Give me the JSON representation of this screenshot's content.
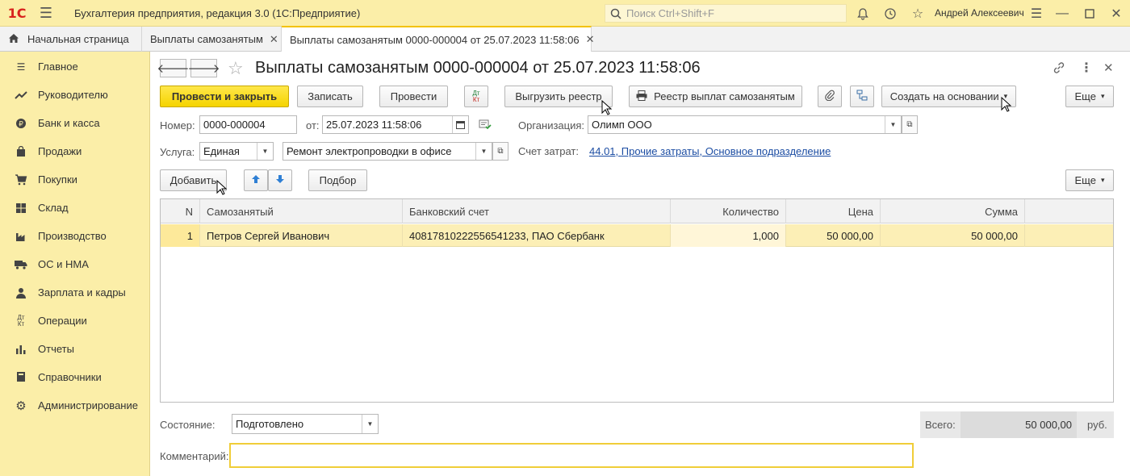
{
  "app": {
    "logo": "1С",
    "title": "Бухгалтерия предприятия, редакция 3.0  (1С:Предприятие)",
    "search_placeholder": "Поиск Ctrl+Shift+F",
    "user": "Андрей Алексеевич"
  },
  "tabs": [
    {
      "label": "Начальная страница"
    },
    {
      "label": "Выплаты самозанятым"
    },
    {
      "label": "Выплаты самозанятым 0000-000004 от 25.07.2023 11:58:06"
    }
  ],
  "sidebar": {
    "items": [
      {
        "label": "Главное",
        "icon": "list-icon"
      },
      {
        "label": "Руководителю",
        "icon": "trend-icon"
      },
      {
        "label": "Банк и касса",
        "icon": "coin-icon"
      },
      {
        "label": "Продажи",
        "icon": "bag-icon"
      },
      {
        "label": "Покупки",
        "icon": "cart-icon"
      },
      {
        "label": "Склад",
        "icon": "warehouse-icon"
      },
      {
        "label": "Производство",
        "icon": "factory-icon"
      },
      {
        "label": "ОС и НМА",
        "icon": "truck-icon"
      },
      {
        "label": "Зарплата и кадры",
        "icon": "person-icon"
      },
      {
        "label": "Операции",
        "icon": "dt-kt-icon"
      },
      {
        "label": "Отчеты",
        "icon": "bar-chart-icon"
      },
      {
        "label": "Справочники",
        "icon": "book-icon"
      },
      {
        "label": "Администрирование",
        "icon": "gear-icon"
      }
    ]
  },
  "doc": {
    "title": "Выплаты самозанятым 0000-000004 от 25.07.2023 11:58:06"
  },
  "toolbar": {
    "post_close": "Провести и закрыть",
    "save": "Записать",
    "post": "Провести",
    "dtkt": "Дт Кт",
    "export_registry": "Выгрузить реестр",
    "payment_registry": "Реестр выплат самозанятым",
    "create_based": "Создать на основании",
    "more": "Еще"
  },
  "form": {
    "number_label": "Номер:",
    "number_value": "0000-000004",
    "date_label": "от:",
    "date_value": "25.07.2023 11:58:06",
    "org_label": "Организация:",
    "org_value": "Олимп ООО",
    "service_label": "Услуга:",
    "service_type": "Единая",
    "service_value": "Ремонт электропроводки в офисе",
    "cost_account_label": "Счет затрат:",
    "cost_account_value": "44.01, Прочие затраты, Основное подразделение"
  },
  "table_toolbar": {
    "add": "Добавить",
    "select": "Подбор",
    "more": "Еще"
  },
  "table": {
    "columns": [
      "N",
      "Самозанятый",
      "Банковский счет",
      "Количество",
      "Цена",
      "Сумма"
    ],
    "rows": [
      {
        "n": "1",
        "person": "Петров Сергей Иванович",
        "account": "40817810222556541233, ПАО Сбербанк",
        "qty": "1,000",
        "price": "50 000,00",
        "sum": "50 000,00"
      }
    ]
  },
  "footer": {
    "state_label": "Состояние:",
    "state_value": "Подготовлено",
    "total_label": "Всего:",
    "total_value": "50 000,00",
    "currency": "руб.",
    "comment_label": "Комментарий:",
    "comment_value": ""
  },
  "colors": {
    "accent_yellow": "#f5d400",
    "panel_yellow": "#fbeea8",
    "row_highlight": "#fcefb6",
    "link": "#1c4da3"
  }
}
